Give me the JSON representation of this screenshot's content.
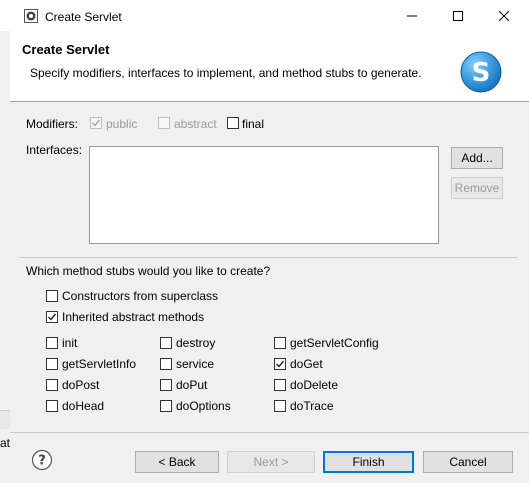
{
  "window": {
    "title": "Create Servlet"
  },
  "banner": {
    "title": "Create Servlet",
    "description": "Specify modifiers, interfaces to implement, and method stubs to generate."
  },
  "modifiers": {
    "label": "Modifiers:",
    "options": [
      {
        "label": "public",
        "checked": true,
        "disabled": true
      },
      {
        "label": "abstract",
        "checked": false,
        "disabled": true
      },
      {
        "label": "final",
        "checked": false,
        "disabled": false
      }
    ]
  },
  "interfaces": {
    "label": "Interfaces:",
    "add_label": "Add...",
    "remove_label": "Remove"
  },
  "stubs": {
    "question": "Which method stubs would you like to create?",
    "constructors": {
      "label": "Constructors from superclass",
      "checked": false
    },
    "inherited": {
      "label": "Inherited abstract methods",
      "checked": true
    },
    "methods": [
      {
        "label": "init",
        "checked": false
      },
      {
        "label": "destroy",
        "checked": false
      },
      {
        "label": "getServletConfig",
        "checked": false
      },
      {
        "label": "getServletInfo",
        "checked": false
      },
      {
        "label": "service",
        "checked": false
      },
      {
        "label": "doGet",
        "checked": true
      },
      {
        "label": "doPost",
        "checked": false
      },
      {
        "label": "doPut",
        "checked": false
      },
      {
        "label": "doDelete",
        "checked": false
      },
      {
        "label": "doHead",
        "checked": false
      },
      {
        "label": "doOptions",
        "checked": false
      },
      {
        "label": "doTrace",
        "checked": false
      }
    ]
  },
  "footer": {
    "back_label": "< Back",
    "next_label": "Next >",
    "finish_label": "Finish",
    "cancel_label": "Cancel"
  },
  "background_fragment": "at v",
  "colors": {
    "accent": "#0078d7",
    "logo": "#1e90d6"
  }
}
